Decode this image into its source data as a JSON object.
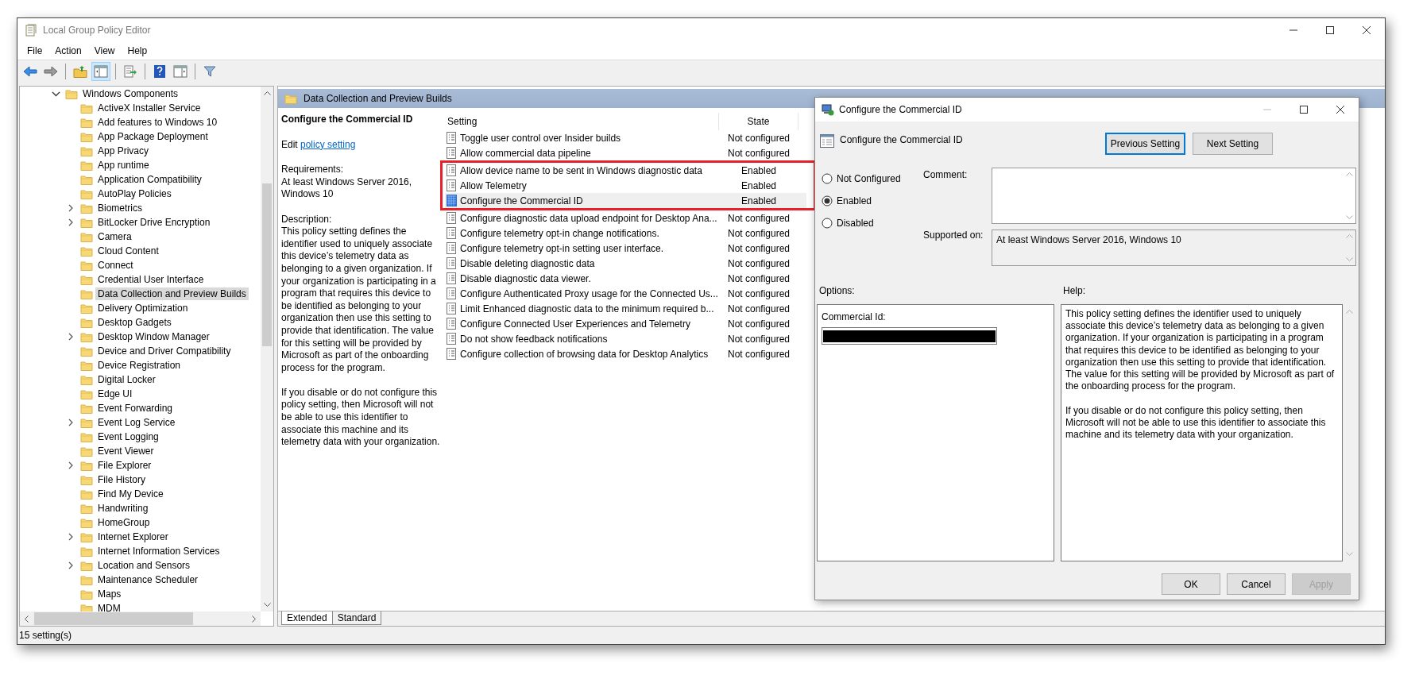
{
  "window": {
    "title": "Local Group Policy Editor"
  },
  "menu": [
    {
      "label": "File"
    },
    {
      "label": "Action"
    },
    {
      "label": "View"
    },
    {
      "label": "Help"
    }
  ],
  "toolbar": [
    {
      "kind": "back",
      "pressed": false
    },
    {
      "kind": "forward",
      "pressed": false
    },
    {
      "kind": "separator"
    },
    {
      "kind": "up",
      "pressed": false
    },
    {
      "kind": "tree",
      "pressed": true
    },
    {
      "kind": "separator"
    },
    {
      "kind": "export",
      "pressed": false
    },
    {
      "kind": "separator"
    },
    {
      "kind": "help",
      "pressed": false
    },
    {
      "kind": "pane",
      "pressed": false
    },
    {
      "kind": "separator"
    },
    {
      "kind": "filter",
      "pressed": false
    }
  ],
  "tree": {
    "items": [
      {
        "label": "Windows Components",
        "expanded": true,
        "selected": false,
        "children": [
          {
            "label": "ActiveX Installer Service",
            "expandable": false,
            "selected": false
          },
          {
            "label": "Add features to Windows 10",
            "expandable": false,
            "selected": false
          },
          {
            "label": "App Package Deployment",
            "expandable": false,
            "selected": false
          },
          {
            "label": "App Privacy",
            "expandable": false,
            "selected": false
          },
          {
            "label": "App runtime",
            "expandable": false,
            "selected": false
          },
          {
            "label": "Application Compatibility",
            "expandable": false,
            "selected": false
          },
          {
            "label": "AutoPlay Policies",
            "expandable": false,
            "selected": false
          },
          {
            "label": "Biometrics",
            "expandable": true,
            "selected": false
          },
          {
            "label": "BitLocker Drive Encryption",
            "expandable": true,
            "selected": false
          },
          {
            "label": "Camera",
            "expandable": false,
            "selected": false
          },
          {
            "label": "Cloud Content",
            "expandable": false,
            "selected": false
          },
          {
            "label": "Connect",
            "expandable": false,
            "selected": false
          },
          {
            "label": "Credential User Interface",
            "expandable": false,
            "selected": false
          },
          {
            "label": "Data Collection and Preview Builds",
            "expandable": false,
            "selected": true
          },
          {
            "label": "Delivery Optimization",
            "expandable": false,
            "selected": false
          },
          {
            "label": "Desktop Gadgets",
            "expandable": false,
            "selected": false
          },
          {
            "label": "Desktop Window Manager",
            "expandable": true,
            "selected": false
          },
          {
            "label": "Device and Driver Compatibility",
            "expandable": false,
            "selected": false
          },
          {
            "label": "Device Registration",
            "expandable": false,
            "selected": false
          },
          {
            "label": "Digital Locker",
            "expandable": false,
            "selected": false
          },
          {
            "label": "Edge UI",
            "expandable": false,
            "selected": false
          },
          {
            "label": "Event Forwarding",
            "expandable": false,
            "selected": false
          },
          {
            "label": "Event Log Service",
            "expandable": true,
            "selected": false
          },
          {
            "label": "Event Logging",
            "expandable": false,
            "selected": false
          },
          {
            "label": "Event Viewer",
            "expandable": false,
            "selected": false
          },
          {
            "label": "File Explorer",
            "expandable": true,
            "selected": false
          },
          {
            "label": "File History",
            "expandable": false,
            "selected": false
          },
          {
            "label": "Find My Device",
            "expandable": false,
            "selected": false
          },
          {
            "label": "Handwriting",
            "expandable": false,
            "selected": false
          },
          {
            "label": "HomeGroup",
            "expandable": false,
            "selected": false
          },
          {
            "label": "Internet Explorer",
            "expandable": true,
            "selected": false
          },
          {
            "label": "Internet Information Services",
            "expandable": false,
            "selected": false
          },
          {
            "label": "Location and Sensors",
            "expandable": true,
            "selected": false
          },
          {
            "label": "Maintenance Scheduler",
            "expandable": false,
            "selected": false
          },
          {
            "label": "Maps",
            "expandable": false,
            "selected": false
          },
          {
            "label": "MDM",
            "expandable": false,
            "selected": false
          }
        ]
      }
    ]
  },
  "details": {
    "header": "Data Collection and Preview Builds",
    "title": "Configure the Commercial ID",
    "edit_prefix": "Edit",
    "edit_link": "policy setting",
    "requirements_label": "Requirements:",
    "requirements": "At least Windows Server 2016, Windows 10",
    "description_label": "Description:",
    "description": [
      "This policy setting defines the identifier used to uniquely associate this device’s telemetry data as belonging to a given organization. If your organization is participating in a program that requires this device to be identified as belonging to your organization then use this setting to provide that identification. The value for this setting will be provided by Microsoft as part of the onboarding process for the program.",
      "If you disable or do not configure this policy setting, then Microsoft will not be able to use this identifier to associate this machine and its telemetry data with your organization."
    ]
  },
  "table": {
    "columns": [
      "Setting",
      "State"
    ],
    "rows": [
      {
        "setting": "Toggle user control over Insider builds",
        "state": "Not configured",
        "selected": false,
        "highlighted": false
      },
      {
        "setting": "Allow commercial data pipeline",
        "state": "Not configured",
        "selected": false,
        "highlighted": false
      },
      {
        "setting": "Allow device name to be sent in Windows diagnostic data",
        "state": "Enabled",
        "selected": false,
        "highlighted": true
      },
      {
        "setting": "Allow Telemetry",
        "state": "Enabled",
        "selected": false,
        "highlighted": true
      },
      {
        "setting": "Configure the Commercial ID",
        "state": "Enabled",
        "selected": true,
        "highlighted": true
      },
      {
        "setting": "Configure diagnostic data upload endpoint for Desktop Ana...",
        "state": "Not configured",
        "selected": false,
        "highlighted": false
      },
      {
        "setting": "Configure telemetry opt-in change notifications.",
        "state": "Not configured",
        "selected": false,
        "highlighted": false
      },
      {
        "setting": "Configure telemetry opt-in setting user interface.",
        "state": "Not configured",
        "selected": false,
        "highlighted": false
      },
      {
        "setting": "Disable deleting diagnostic data",
        "state": "Not configured",
        "selected": false,
        "highlighted": false
      },
      {
        "setting": "Disable diagnostic data viewer.",
        "state": "Not configured",
        "selected": false,
        "highlighted": false
      },
      {
        "setting": "Configure Authenticated Proxy usage for the Connected Us...",
        "state": "Not configured",
        "selected": false,
        "highlighted": false
      },
      {
        "setting": "Limit Enhanced diagnostic data to the minimum required b...",
        "state": "Not configured",
        "selected": false,
        "highlighted": false
      },
      {
        "setting": "Configure Connected User Experiences and Telemetry",
        "state": "Not configured",
        "selected": false,
        "highlighted": false
      },
      {
        "setting": "Do not show feedback notifications",
        "state": "Not configured",
        "selected": false,
        "highlighted": false
      },
      {
        "setting": "Configure collection of browsing data for Desktop Analytics",
        "state": "Not configured",
        "selected": false,
        "highlighted": false
      }
    ]
  },
  "view_tabs": [
    {
      "label": "Extended",
      "selected": true
    },
    {
      "label": "Standard",
      "selected": false
    }
  ],
  "status_bar": "15 setting(s)",
  "dialog": {
    "title": "Configure the Commercial ID",
    "heading": "Configure the Commercial ID",
    "nav_buttons": [
      {
        "label": "Previous Setting",
        "focused": true
      },
      {
        "label": "Next Setting",
        "focused": false
      }
    ],
    "options": [
      {
        "label": "Not Configured",
        "selected": false
      },
      {
        "label": "Enabled",
        "selected": true
      },
      {
        "label": "Disabled",
        "selected": false
      }
    ],
    "comment_label": "Comment:",
    "supported_label": "Supported on:",
    "supported": "At least Windows Server 2016, Windows 10",
    "options_label": "Options:",
    "help_label": "Help:",
    "option_fields": [
      {
        "label": "Commercial Id:",
        "redacted": true
      }
    ],
    "help": [
      "This policy setting defines the identifier used to uniquely associate this device’s telemetry data as belonging to a given organization. If your organization is participating in a program that requires this device to be identified as belonging to your organization then use this setting to provide that identification. The value for this setting will be provided by Microsoft as part of the onboarding process for the program.",
      "If you disable or do not configure this policy setting, then Microsoft will not be able to use this identifier to associate this machine and its telemetry data with your organization."
    ],
    "buttons": [
      {
        "label": "OK",
        "disabled": false
      },
      {
        "label": "Cancel",
        "disabled": false
      },
      {
        "label": "Apply",
        "disabled": true
      }
    ]
  }
}
